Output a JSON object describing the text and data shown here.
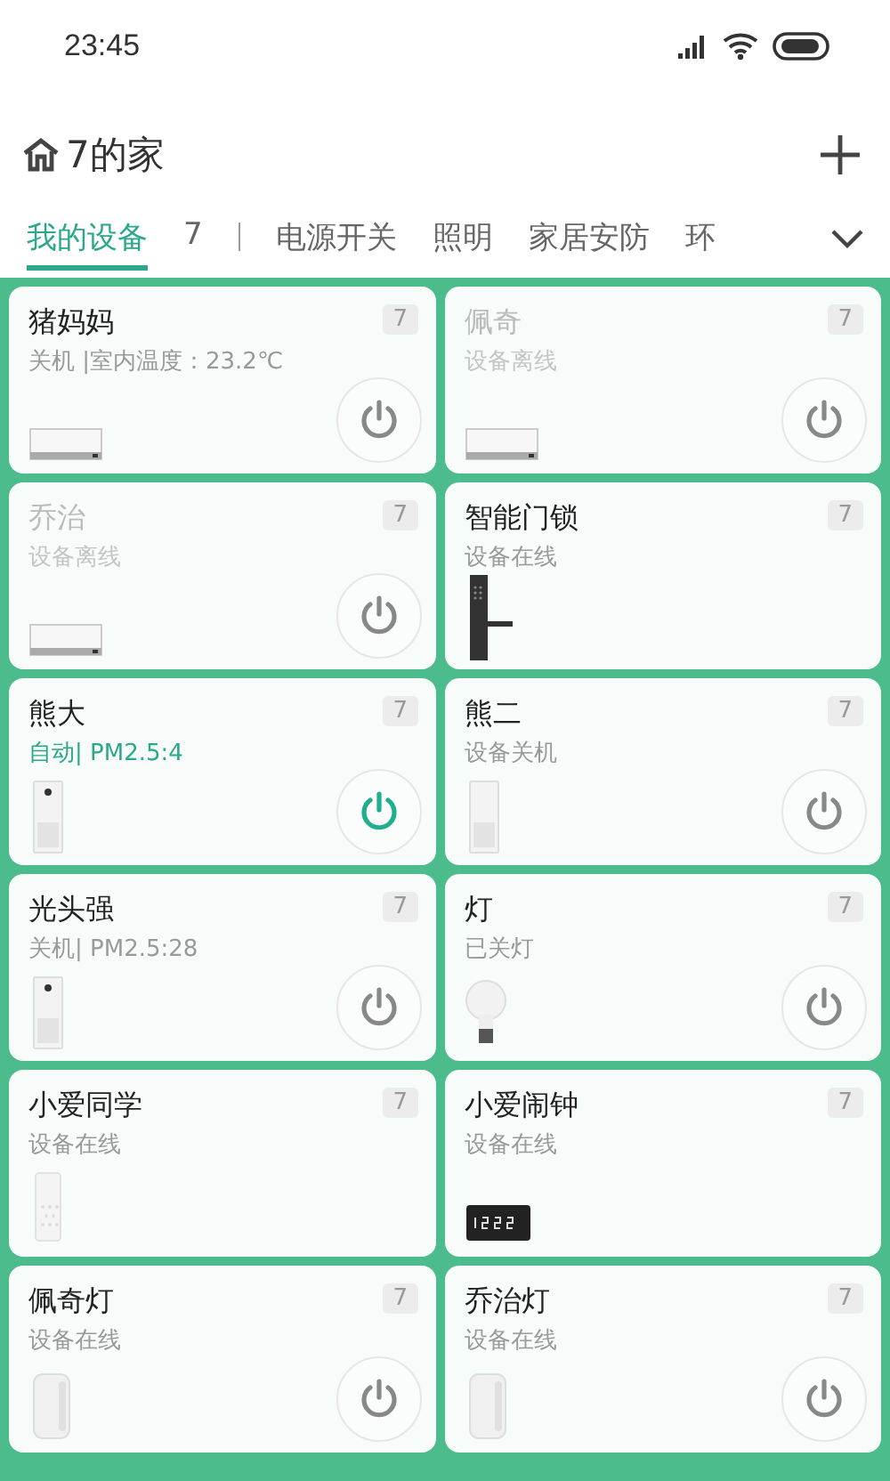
{
  "status_bar": {
    "time": "23:45"
  },
  "header": {
    "title": "7的家"
  },
  "tabs": [
    {
      "label": "我的设备",
      "selected": true
    },
    {
      "label": "7",
      "selected": false
    },
    {
      "label": "电源开关",
      "selected": false
    },
    {
      "label": "照明",
      "selected": false
    },
    {
      "label": "家居安防",
      "selected": false
    },
    {
      "label": "环",
      "selected": false
    }
  ],
  "devices": [
    {
      "name": "猪妈妈",
      "status": "关机 |室内温度：23.2℃",
      "badge": "7",
      "kind": "ac",
      "online": true,
      "on": false,
      "power_button": true
    },
    {
      "name": "佩奇",
      "status": "设备离线",
      "badge": "7",
      "kind": "ac",
      "online": false,
      "on": false,
      "power_button": true
    },
    {
      "name": "乔治",
      "status": "设备离线",
      "badge": "7",
      "kind": "ac",
      "online": false,
      "on": false,
      "power_button": true
    },
    {
      "name": "智能门锁",
      "status": "设备在线",
      "badge": "7",
      "kind": "lock",
      "online": true,
      "power_button": false
    },
    {
      "name": "熊大",
      "status": "自动| PM2.5:4",
      "badge": "7",
      "kind": "purifier",
      "online": true,
      "on": true,
      "power_button": true
    },
    {
      "name": "熊二",
      "status": "设备关机",
      "badge": "7",
      "kind": "purifier2",
      "online": true,
      "on": false,
      "power_button": true
    },
    {
      "name": "光头强",
      "status": "关机| PM2.5:28",
      "badge": "7",
      "kind": "purifier",
      "online": true,
      "on": false,
      "power_button": true
    },
    {
      "name": "灯",
      "status": "已关灯",
      "badge": "7",
      "kind": "bulb",
      "online": true,
      "on": false,
      "power_button": true
    },
    {
      "name": "小爱同学",
      "status": "设备在线",
      "badge": "7",
      "kind": "speaker",
      "online": true,
      "power_button": false
    },
    {
      "name": "小爱闹钟",
      "status": "设备在线",
      "badge": "7",
      "kind": "clock",
      "online": true,
      "power_button": false
    },
    {
      "name": "佩奇灯",
      "status": "设备在线",
      "badge": "7",
      "kind": "lamp",
      "online": true,
      "on": false,
      "power_button": true
    },
    {
      "name": "乔治灯",
      "status": "设备在线",
      "badge": "7",
      "kind": "lamp",
      "online": true,
      "on": false,
      "power_button": true
    }
  ]
}
